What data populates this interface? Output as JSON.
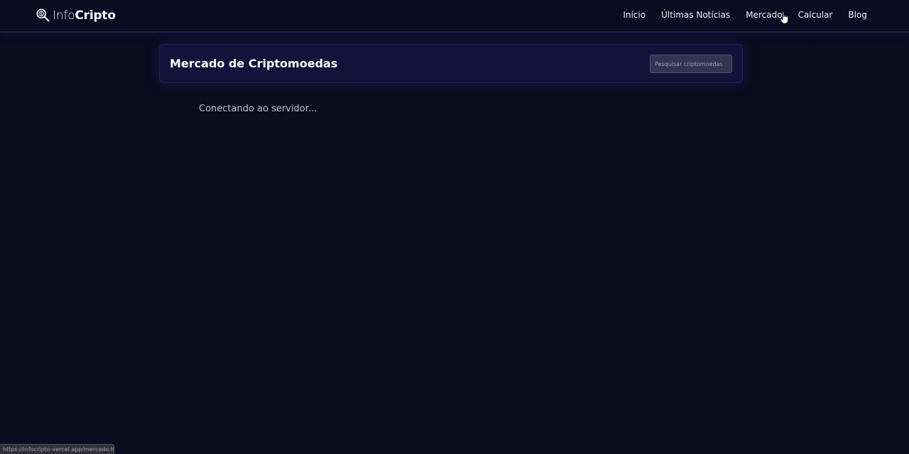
{
  "brand": {
    "light": "Info",
    "bold": "Cripto"
  },
  "nav": {
    "items": [
      {
        "label": "Início"
      },
      {
        "label": "Últimas Notícias"
      },
      {
        "label": "Mercado"
      },
      {
        "label": "Calcular"
      },
      {
        "label": "Blog"
      }
    ]
  },
  "market": {
    "title": "Mercado de Criptomoedas",
    "search_placeholder": "Pesquisar criptomoedas"
  },
  "status": {
    "message": "Conectando ao servidor..."
  },
  "browser_status": {
    "url": "https://infocripto-vercel.app/mercado.html"
  },
  "colors": {
    "background": "#0b0a1f",
    "card": "#14123a",
    "input": "#35334f",
    "text": "#ffffff"
  },
  "icons": {
    "logo": "magnifier-icon",
    "cursor": "hand-pointer-icon"
  }
}
